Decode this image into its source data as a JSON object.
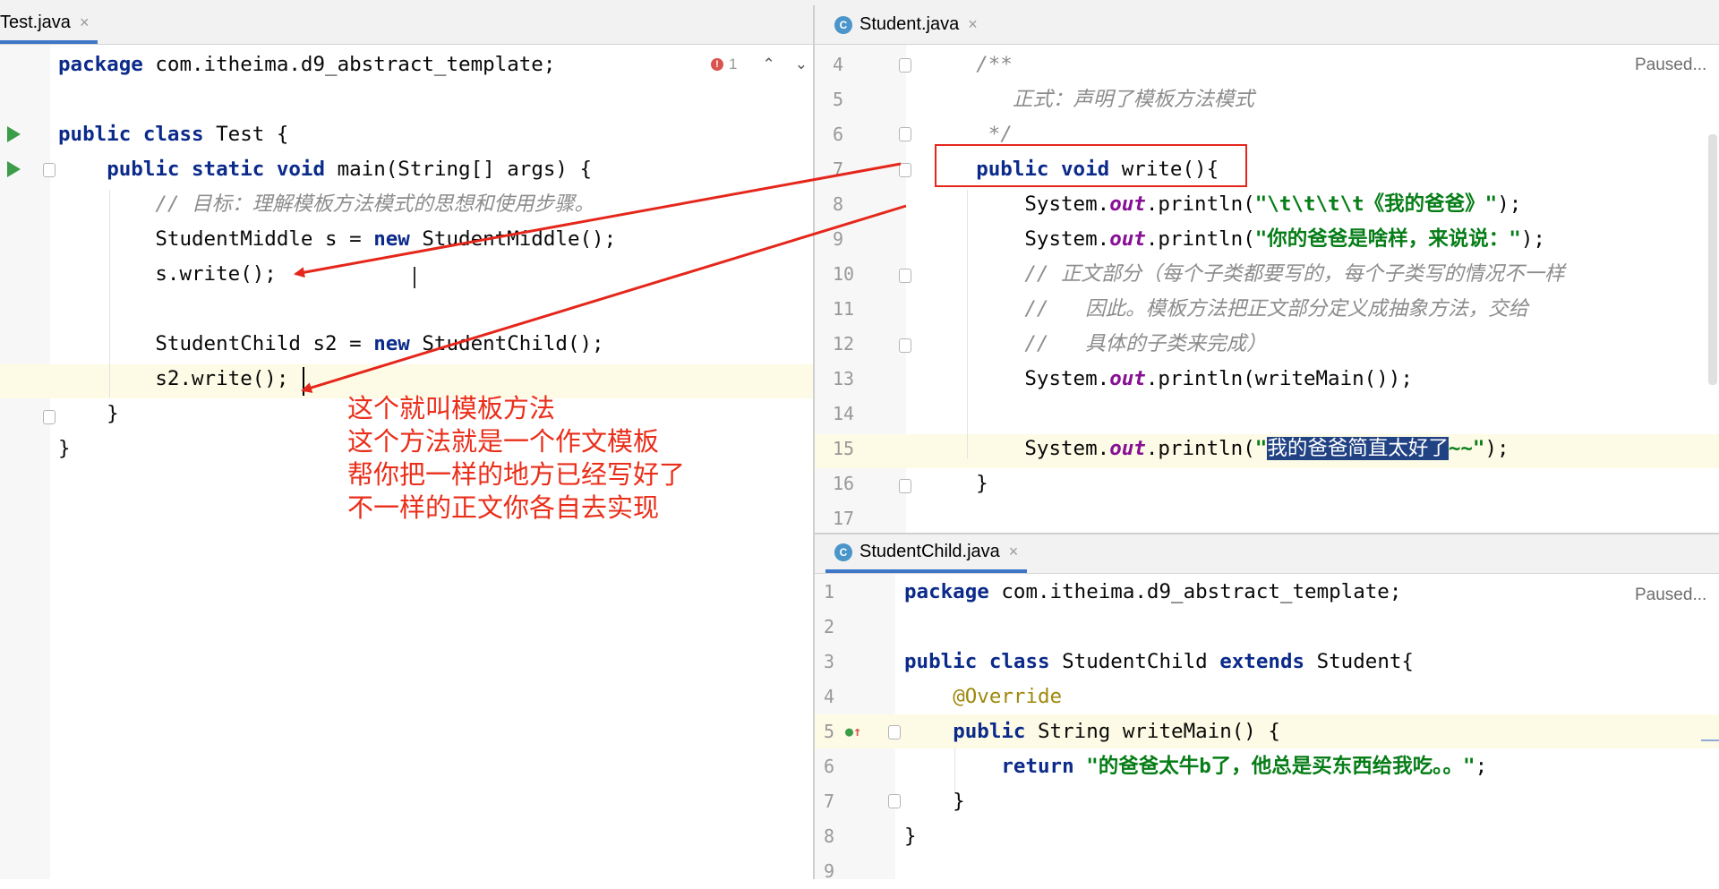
{
  "left_editor": {
    "tab": {
      "label": "Test.java",
      "close": "×"
    },
    "inspection": {
      "count": "1"
    },
    "lines": [
      [
        {
          "t": "package",
          "c": "kw"
        },
        {
          "t": " com.itheima.d9_abstract_template;"
        }
      ],
      [],
      [
        {
          "t": "public class",
          "c": "kw"
        },
        {
          "t": " Test {"
        }
      ],
      [
        {
          "t": "    "
        },
        {
          "t": "public static void",
          "c": "kw"
        },
        {
          "t": " main(String[] args) {"
        }
      ],
      [
        {
          "t": "        "
        },
        {
          "t": "// 目标：理解模板方法模式的思想和使用步骤。",
          "c": "cm"
        }
      ],
      [
        {
          "t": "        StudentMiddle s = "
        },
        {
          "t": "new",
          "c": "kw"
        },
        {
          "t": " StudentMiddle();"
        }
      ],
      [
        {
          "t": "        s.write();"
        }
      ],
      [],
      [
        {
          "t": "        StudentChild s2 = "
        },
        {
          "t": "new",
          "c": "kw"
        },
        {
          "t": " StudentChild();"
        }
      ],
      [
        {
          "t": "        s2.write();"
        }
      ],
      [
        {
          "t": "    }"
        }
      ],
      [
        {
          "t": "}"
        }
      ]
    ]
  },
  "annotation_note": "这个就叫模板方法\n这个方法就是一个作文模板\n帮你把一样的地方已经写好了\n不一样的正文你各自去实现",
  "top_right_editor": {
    "tab": {
      "label": "Student.java",
      "close": "×",
      "icon": "C"
    },
    "status": "Paused...",
    "line_numbers": [
      "4",
      "5",
      "6",
      "7",
      "8",
      "9",
      "10",
      "11",
      "12",
      "13",
      "14",
      "15",
      "16",
      "17"
    ],
    "lines": [
      [
        {
          "t": "    "
        },
        {
          "t": "/**",
          "c": "cm"
        }
      ],
      [
        {
          "t": "       "
        },
        {
          "t": "正式：声明了模板方法模式",
          "c": "cm"
        }
      ],
      [
        {
          "t": "     "
        },
        {
          "t": "*/",
          "c": "cm"
        }
      ],
      [
        {
          "t": "    "
        },
        {
          "t": "public void",
          "c": "kw"
        },
        {
          "t": " write(){"
        }
      ],
      [
        {
          "t": "        System."
        },
        {
          "t": "out",
          "c": "fld"
        },
        {
          "t": ".println("
        },
        {
          "t": "\"\\t\\t\\t\\t《我的爸爸》\"",
          "c": "str"
        },
        {
          "t": ");"
        }
      ],
      [
        {
          "t": "        System."
        },
        {
          "t": "out",
          "c": "fld"
        },
        {
          "t": ".println("
        },
        {
          "t": "\"你的爸爸是啥样，来说说：\"",
          "c": "str"
        },
        {
          "t": ");"
        }
      ],
      [
        {
          "t": "        "
        },
        {
          "t": "// 正文部分（每个子类都要写的，每个子类写的情况不一样",
          "c": "cm"
        }
      ],
      [
        {
          "t": "        "
        },
        {
          "t": "//   因此。模板方法把正文部分定义成抽象方法，交给",
          "c": "cm"
        }
      ],
      [
        {
          "t": "        "
        },
        {
          "t": "//   具体的子类来完成）",
          "c": "cm"
        }
      ],
      [
        {
          "t": "        System."
        },
        {
          "t": "out",
          "c": "fld"
        },
        {
          "t": ".println(writeMain());"
        }
      ],
      [],
      [
        {
          "t": "        System."
        },
        {
          "t": "out",
          "c": "fld"
        },
        {
          "t": ".println("
        },
        {
          "t": "\"",
          "c": "str"
        },
        {
          "t": "我的爸爸简直太好了",
          "c": "sel"
        },
        {
          "t": "~~\"",
          "c": "str"
        },
        {
          "t": ");"
        }
      ],
      [
        {
          "t": "    }"
        }
      ],
      []
    ]
  },
  "bottom_right_editor": {
    "tab": {
      "label": "StudentChild.java",
      "close": "×",
      "icon": "C"
    },
    "status": "Paused...",
    "line_numbers": [
      "1",
      "2",
      "3",
      "4",
      "5",
      "6",
      "7",
      "8",
      "9"
    ],
    "lines": [
      [
        {
          "t": "package",
          "c": "kw"
        },
        {
          "t": " com.itheima.d9_abstract_template;"
        }
      ],
      [],
      [
        {
          "t": "public class",
          "c": "kw"
        },
        {
          "t": " StudentChild "
        },
        {
          "t": "extends",
          "c": "kw"
        },
        {
          "t": " Student{"
        }
      ],
      [
        {
          "t": "    "
        },
        {
          "t": "@Override",
          "c": "ann"
        }
      ],
      [
        {
          "t": "    "
        },
        {
          "t": "public",
          "c": "kw"
        },
        {
          "t": " String writeMain() {"
        }
      ],
      [
        {
          "t": "        "
        },
        {
          "t": "return",
          "c": "kw"
        },
        {
          "t": " "
        },
        {
          "t": "\"的爸爸太牛b了，他总是买东西给我吃。。\"",
          "c": "str"
        },
        {
          "t": ";"
        }
      ],
      [
        {
          "t": "    }"
        }
      ],
      [
        {
          "t": "}"
        }
      ],
      []
    ]
  },
  "colors": {
    "annotation_red": "#e5261b",
    "keyword": "#0b2a8a",
    "string": "#067d17",
    "comment": "#8c8c8c",
    "selection": "#214283"
  }
}
